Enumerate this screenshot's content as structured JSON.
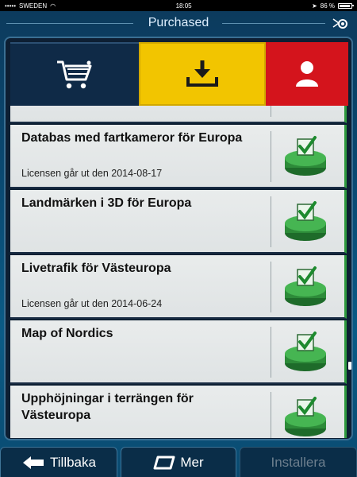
{
  "status_bar": {
    "carrier": "SWEDEN",
    "time": "18:05",
    "battery": "86 %"
  },
  "header": {
    "title": "Purchased"
  },
  "tabs": [
    {
      "name": "cart",
      "icon": "shopping-cart-icon",
      "color": "#0f2a47"
    },
    {
      "name": "download",
      "icon": "download-icon",
      "color": "#f2c500"
    },
    {
      "name": "account",
      "icon": "user-icon",
      "color": "#d4141c"
    }
  ],
  "items": [
    {
      "name": "Databas med fartkameror för Europa",
      "license": "Licensen går ut den 2014-08-17"
    },
    {
      "name": "Landmärken i 3D för Europa",
      "license": ""
    },
    {
      "name": "Livetrafik för Västeuropa",
      "license": "Licensen går ut den 2014-06-24"
    },
    {
      "name": "Map of Nordics",
      "license": ""
    },
    {
      "name": "Upphöjningar i terrängen för Västeuropa",
      "license": ""
    }
  ],
  "footer": {
    "back_label": "Tillbaka",
    "more_label": "Mer",
    "install_label": "Installera"
  },
  "colors": {
    "accent_yellow": "#f2c500",
    "accent_red": "#d4141c",
    "check_green": "#2e9a3e"
  }
}
